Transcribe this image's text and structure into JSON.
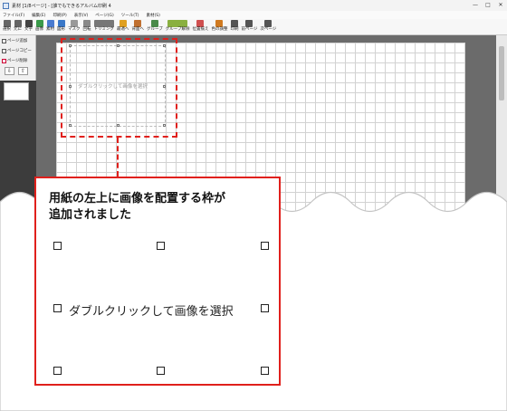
{
  "window": {
    "title": "素材 [1/8ページ] - [誰でもできるアルバム印刷 4",
    "controls": [
      "—",
      "□",
      "✕"
    ]
  },
  "menu": [
    "ファイル(F)",
    "編集(E)",
    "印刷(P)",
    "表示(V)",
    "ページ(G)",
    "ツール(T)",
    "素材(S)"
  ],
  "toolbar": [
    {
      "label": "選択",
      "icon": "cursor-icon",
      "color": "#666666"
    },
    {
      "label": "元に",
      "icon": "undo-icon",
      "color": "#666666"
    },
    {
      "label": "文字",
      "icon": "text-icon",
      "color": "#444444"
    },
    {
      "label": "画像",
      "icon": "image-icon",
      "color": "#3a9a4a"
    },
    {
      "label": "素材",
      "icon": "clip-icon",
      "color": "#4a7bd0"
    },
    {
      "label": "図形",
      "icon": "shape-icon",
      "color": "#3a78c8"
    },
    {
      "label": "マスク",
      "icon": "mask-icon",
      "color": "#999999"
    },
    {
      "label": "回転",
      "icon": "rotate-icon",
      "color": "#888888"
    },
    {
      "label": "トリミング",
      "icon": "crop-icon",
      "color": "#777777"
    },
    {
      "label": "最適へ",
      "icon": "front-icon",
      "color": "#e0a020"
    },
    {
      "label": "背面へ",
      "icon": "back-icon",
      "color": "#c07030"
    },
    {
      "label": "グループ",
      "icon": "group-icon",
      "color": "#4a8a4a"
    },
    {
      "label": "グループ解除",
      "icon": "ungroup-icon",
      "color": "#8ab040"
    },
    {
      "label": "位置揃え",
      "icon": "align-icon",
      "color": "#d05050"
    },
    {
      "label": "色の調整",
      "icon": "color-adjust-icon",
      "color": "#d07a20"
    },
    {
      "label": "印刷",
      "icon": "printer-icon",
      "color": "#555555"
    },
    {
      "label": "前ページ",
      "icon": "prev-page-icon",
      "color": "#555555"
    },
    {
      "label": "次ページ",
      "icon": "next-page-icon",
      "color": "#555555"
    }
  ],
  "sidebar": {
    "buttons": [
      "ページ追加",
      "ページコピー",
      "ページ削除"
    ],
    "arrows": [
      "⇩",
      "⇧"
    ]
  },
  "page_frame_hint": "ダブルクリックして画像を選択",
  "callout": {
    "title_line1": "用紙の左上に画像を配置する枠が",
    "title_line2": "追加されました",
    "frame_hint": "ダブルクリックして画像を選択"
  },
  "accent": "#e0201c"
}
